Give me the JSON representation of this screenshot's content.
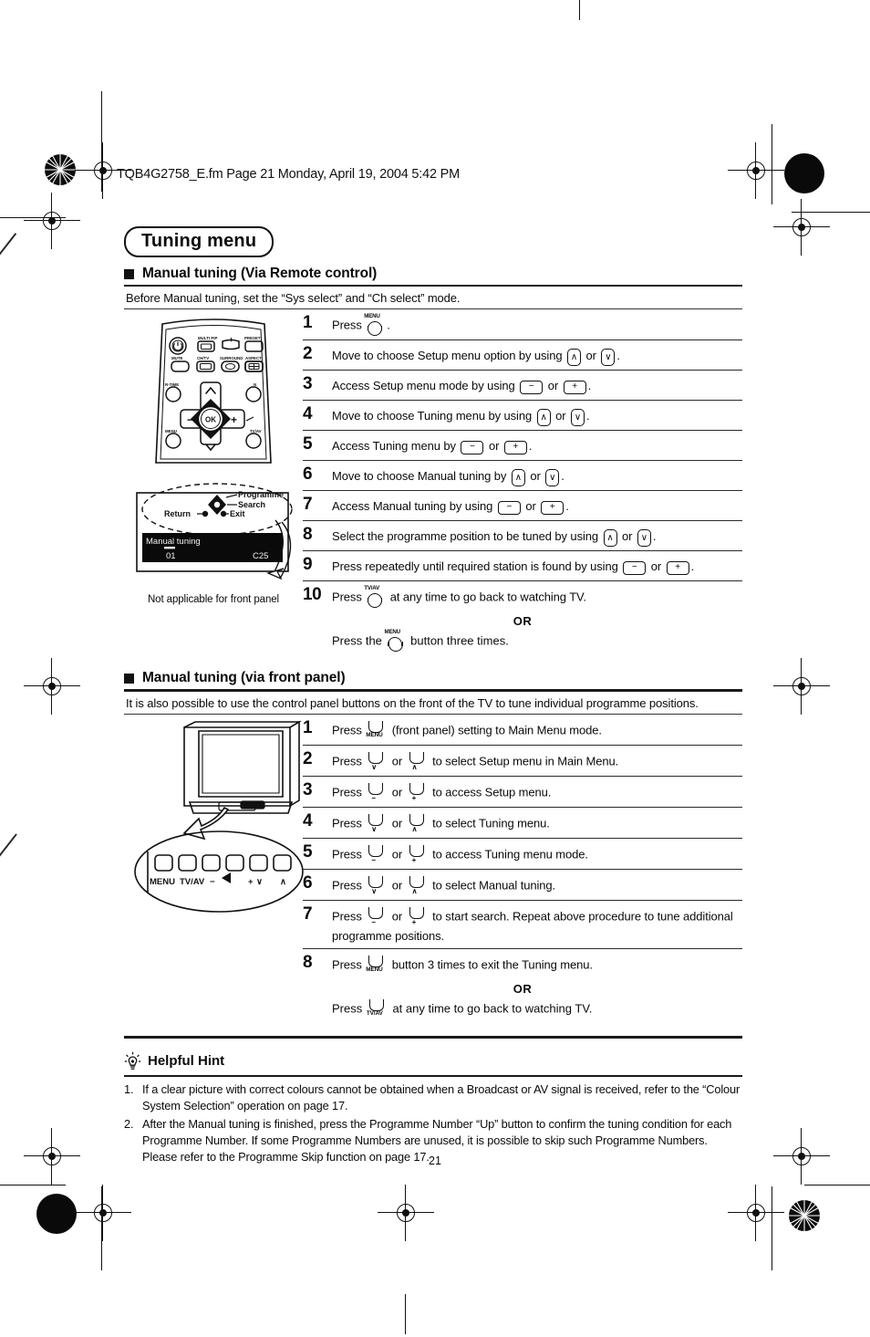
{
  "print_header": "TQB4G2758_E.fm  Page 21  Monday, April 19, 2004  5:42 PM",
  "chapter_title": "Tuning menu",
  "page_number": "21",
  "remote_section": {
    "heading": "Manual tuning (Via Remote control)",
    "intro": "Before Manual tuning, set the “Sys select” and “Ch select” mode.",
    "figure": {
      "remote_keys": {
        "power": "⏻",
        "multi_pip": "MULTI PIP",
        "preset": "PRESET",
        "mute": "MUTE",
        "ch_tv": "CH/TV",
        "surround": "SURROUND",
        "aspect": "ASPECT",
        "r_time": "R-TIME",
        "n": "N",
        "ok": "OK",
        "minus": "−",
        "plus": "+",
        "menu": "MENU",
        "tv_av": "TV/AV",
        "up": "∧",
        "down": "∨"
      },
      "osd": {
        "title": "Manual tuning",
        "programme_number": "01",
        "channel": "C25",
        "label_programme": "Programme",
        "label_search": "Search",
        "label_return": "Return",
        "label_exit": "Exit"
      },
      "caption": "Not applicable for front panel"
    },
    "steps": [
      {
        "num": "1",
        "parts": [
          {
            "t": "text",
            "v": "Press "
          },
          {
            "t": "key-round",
            "v": "MENU"
          },
          {
            "t": "text",
            "v": "."
          }
        ]
      },
      {
        "num": "2",
        "parts": [
          {
            "t": "text",
            "v": "Move to choose Setup menu option by using "
          },
          {
            "t": "key-ud",
            "v": "∧"
          },
          {
            "t": "text",
            "v": " or "
          },
          {
            "t": "key-ud",
            "v": "∨"
          },
          {
            "t": "text",
            "v": "."
          }
        ]
      },
      {
        "num": "3",
        "parts": [
          {
            "t": "text",
            "v": "Access Setup menu mode by using "
          },
          {
            "t": "key-pm",
            "v": "−"
          },
          {
            "t": "text",
            "v": " or "
          },
          {
            "t": "key-pm",
            "v": "+"
          },
          {
            "t": "text",
            "v": "."
          }
        ]
      },
      {
        "num": "4",
        "parts": [
          {
            "t": "text",
            "v": "Move to choose Tuning menu by using "
          },
          {
            "t": "key-ud",
            "v": "∧"
          },
          {
            "t": "text",
            "v": " or "
          },
          {
            "t": "key-ud",
            "v": "∨"
          },
          {
            "t": "text",
            "v": "."
          }
        ]
      },
      {
        "num": "5",
        "parts": [
          {
            "t": "text",
            "v": "Access Tuning menu by "
          },
          {
            "t": "key-pm",
            "v": "−"
          },
          {
            "t": "text",
            "v": " or "
          },
          {
            "t": "key-pm",
            "v": "+"
          },
          {
            "t": "text",
            "v": "."
          }
        ]
      },
      {
        "num": "6",
        "parts": [
          {
            "t": "text",
            "v": "Move to choose Manual tuning by "
          },
          {
            "t": "key-ud",
            "v": "∧"
          },
          {
            "t": "text",
            "v": " or "
          },
          {
            "t": "key-ud",
            "v": "∨"
          },
          {
            "t": "text",
            "v": "."
          }
        ]
      },
      {
        "num": "7",
        "parts": [
          {
            "t": "text",
            "v": "Access Manual tuning by using "
          },
          {
            "t": "key-pm",
            "v": "−"
          },
          {
            "t": "text",
            "v": " or "
          },
          {
            "t": "key-pm",
            "v": "+"
          },
          {
            "t": "text",
            "v": "."
          }
        ]
      },
      {
        "num": "8",
        "parts": [
          {
            "t": "text",
            "v": "Select the programme position to be tuned by using "
          },
          {
            "t": "key-ud",
            "v": "∧"
          },
          {
            "t": "text",
            "v": " or "
          },
          {
            "t": "key-ud",
            "v": "∨"
          },
          {
            "t": "text",
            "v": "."
          }
        ]
      },
      {
        "num": "9",
        "parts": [
          {
            "t": "text",
            "v": "Press repeatedly until required station is found by using "
          },
          {
            "t": "key-pm",
            "v": "−"
          },
          {
            "t": "text",
            "v": " or "
          },
          {
            "t": "key-pm",
            "v": "+"
          },
          {
            "t": "text",
            "v": "."
          }
        ]
      },
      {
        "num": "10",
        "parts": [
          {
            "t": "text",
            "v": "Press "
          },
          {
            "t": "key-round",
            "v": "TV/AV"
          },
          {
            "t": "text",
            "v": " at any time to go back to watching TV."
          }
        ],
        "or_label": "OR",
        "alt_parts": [
          {
            "t": "text",
            "v": "Press the "
          },
          {
            "t": "key-round",
            "v": "MENU"
          },
          {
            "t": "text",
            "v": " button three times."
          }
        ]
      }
    ]
  },
  "front_panel_section": {
    "heading": "Manual tuning (via front panel)",
    "intro": "It is also possible to use the control panel buttons on the front of the TV to tune individual programme positions.",
    "figure": {
      "panel_button_labels": [
        "MENU",
        "TV/AV",
        "−",
        "◀",
        "+",
        "∨",
        "∧"
      ]
    },
    "steps": [
      {
        "num": "1",
        "parts": [
          {
            "t": "text",
            "v": "Press "
          },
          {
            "t": "key-panel",
            "v": "MENU"
          },
          {
            "t": "text",
            "v": " (front panel) setting to Main Menu mode."
          }
        ]
      },
      {
        "num": "2",
        "parts": [
          {
            "t": "text",
            "v": "Press "
          },
          {
            "t": "key-panel",
            "v": "∨"
          },
          {
            "t": "text",
            "v": " or "
          },
          {
            "t": "key-panel",
            "v": "∧"
          },
          {
            "t": "text",
            "v": " to select Setup menu in Main Menu."
          }
        ]
      },
      {
        "num": "3",
        "parts": [
          {
            "t": "text",
            "v": "Press "
          },
          {
            "t": "key-panel",
            "v": "−"
          },
          {
            "t": "text",
            "v": " or "
          },
          {
            "t": "key-panel",
            "v": "+"
          },
          {
            "t": "text",
            "v": " to access Setup menu."
          }
        ]
      },
      {
        "num": "4",
        "parts": [
          {
            "t": "text",
            "v": "Press "
          },
          {
            "t": "key-panel",
            "v": "∨"
          },
          {
            "t": "text",
            "v": " or "
          },
          {
            "t": "key-panel",
            "v": "∧"
          },
          {
            "t": "text",
            "v": " to select Tuning menu."
          }
        ]
      },
      {
        "num": "5",
        "parts": [
          {
            "t": "text",
            "v": "Press "
          },
          {
            "t": "key-panel",
            "v": "−"
          },
          {
            "t": "text",
            "v": " or "
          },
          {
            "t": "key-panel",
            "v": "+"
          },
          {
            "t": "text",
            "v": " to access Tuning menu mode."
          }
        ]
      },
      {
        "num": "6",
        "parts": [
          {
            "t": "text",
            "v": "Press "
          },
          {
            "t": "key-panel",
            "v": "∨"
          },
          {
            "t": "text",
            "v": " or "
          },
          {
            "t": "key-panel",
            "v": "∧"
          },
          {
            "t": "text",
            "v": " to select Manual tuning."
          }
        ]
      },
      {
        "num": "7",
        "parts": [
          {
            "t": "text",
            "v": "Press "
          },
          {
            "t": "key-panel",
            "v": "−"
          },
          {
            "t": "text",
            "v": " or "
          },
          {
            "t": "key-panel",
            "v": "+"
          },
          {
            "t": "text",
            "v": " to start search. Repeat above procedure to tune additional programme positions."
          }
        ]
      },
      {
        "num": "8",
        "parts": [
          {
            "t": "text",
            "v": "Press "
          },
          {
            "t": "key-panel",
            "v": "MENU"
          },
          {
            "t": "text",
            "v": " button 3 times to exit the Tuning menu."
          }
        ],
        "or_label": "OR",
        "alt_parts": [
          {
            "t": "text",
            "v": "Press "
          },
          {
            "t": "key-panel",
            "v": "TV/AV"
          },
          {
            "t": "text",
            "v": " at any time to go back to watching TV."
          }
        ]
      }
    ]
  },
  "helpful_hint": {
    "heading": "Helpful Hint",
    "items": [
      {
        "num": "1.",
        "text": "If a clear picture with correct colours cannot be obtained when a Broadcast or AV signal is received, refer to the “Colour System Selection” operation on page 17."
      },
      {
        "num": "2.",
        "text": "After the Manual tuning is finished, press the Programme Number “Up” button to confirm the tuning condition for each Programme Number. If some Programme Numbers are unused, it is possible to skip such Programme Numbers. Please refer to the Programme Skip function on page 17."
      }
    ]
  }
}
